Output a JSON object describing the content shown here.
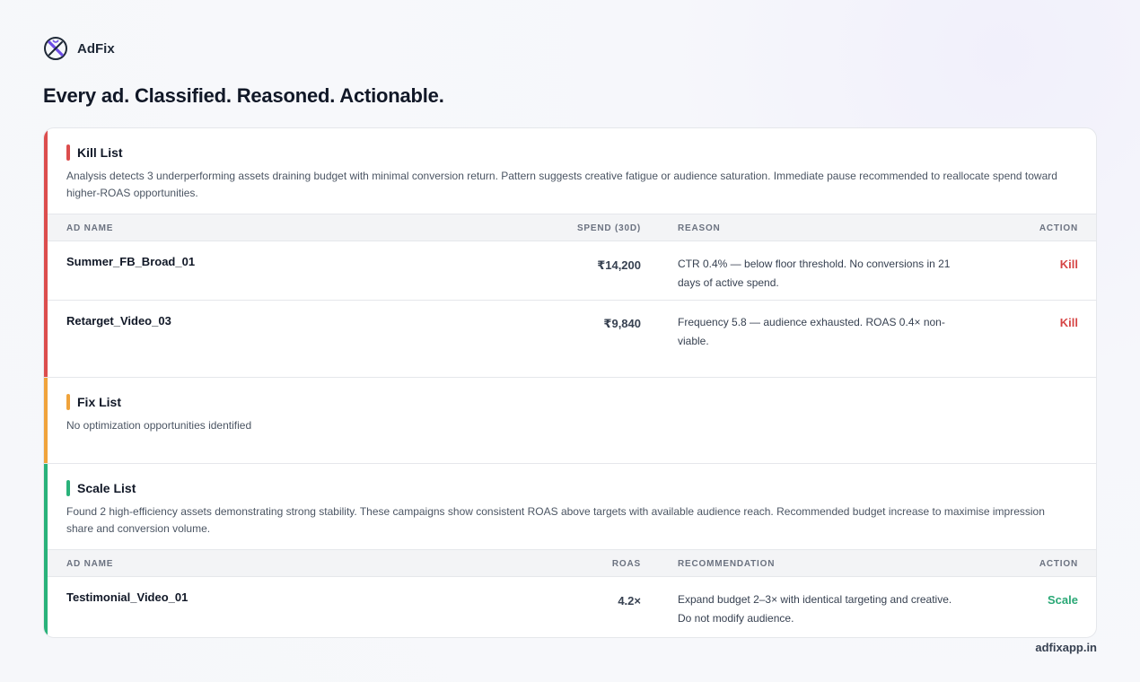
{
  "brand": {
    "name": "AdFix",
    "logo_icon": "adfix-x-logo",
    "logo_color": "#6d4de6"
  },
  "headline": "Every ad. Classified. Reasoned. Actionable.",
  "kill_list": {
    "title": "Kill List",
    "accent": "#dc4d4d",
    "description": "Analysis detects 3 underperforming assets draining budget with minimal conversion return. Pattern suggests creative fatigue or audience saturation. Immediate pause recommended to reallocate spend toward higher-ROAS opportunities.",
    "columns": [
      "AD NAME",
      "SPEND (30D)",
      "REASON",
      "ACTION"
    ],
    "rows": [
      {
        "name": "Summer_FB_Broad_01",
        "value": "₹14,200",
        "reason": "CTR 0.4% — below floor threshold. No conversions in 21 days of active spend.",
        "action": "Kill"
      },
      {
        "name": "Retarget_Video_03",
        "value": "₹9,840",
        "reason": "Frequency 5.8 — audience exhausted. ROAS 0.4× non-viable.",
        "action": "Kill"
      }
    ]
  },
  "fix_list": {
    "title": "Fix List",
    "accent": "#f0a33b",
    "description": "No optimization opportunities identified"
  },
  "scale_list": {
    "title": "Scale List",
    "accent": "#29b27a",
    "description": "Found 2 high-efficiency assets demonstrating strong stability. These campaigns show consistent ROAS above targets with available audience reach. Recommended budget increase to maximise impression share and conversion volume.",
    "columns": [
      "AD NAME",
      "ROAS",
      "RECOMMENDATION",
      "ACTION"
    ],
    "rows": [
      {
        "name": "Testimonial_Video_01",
        "value": "4.2×",
        "reason": "Expand budget 2–3× with identical targeting and creative. Do not modify audience.",
        "action": "Scale"
      }
    ]
  },
  "footer": {
    "link": "adfixapp.in"
  }
}
